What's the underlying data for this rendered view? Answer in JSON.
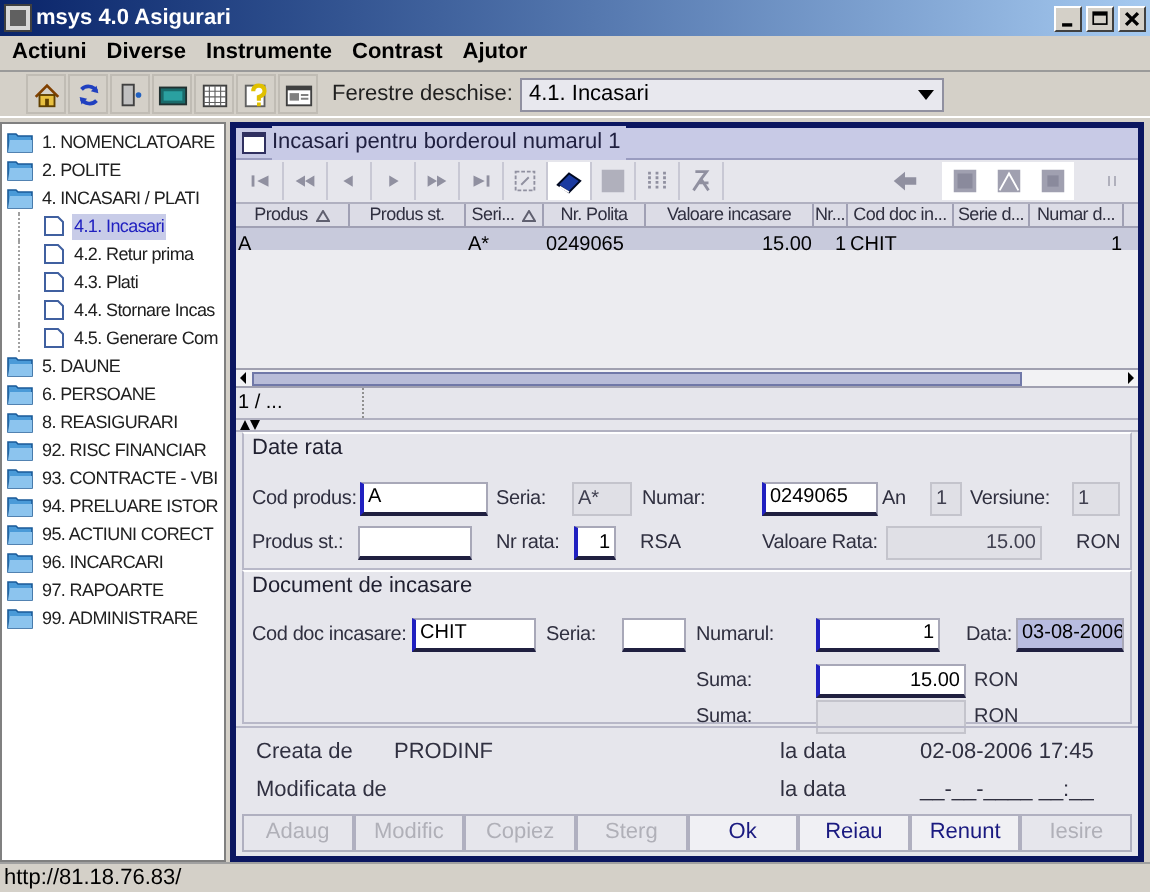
{
  "window": {
    "title": "msys 4.0 Asigurari"
  },
  "menu": [
    "Actiuni",
    "Diverse",
    "Instrumente",
    "Contrast",
    "Ajutor"
  ],
  "toolbar": {
    "open_windows_label": "Ferestre deschise:",
    "open_windows_value": "4.1. Incasari"
  },
  "tree": [
    {
      "label": "1. NOMENCLATOARE",
      "selected": false
    },
    {
      "label": "2. POLITE",
      "selected": false
    },
    {
      "label": "4. INCASARI / PLATI",
      "selected": false,
      "children": [
        {
          "label": "4.1. Incasari",
          "selected": true
        },
        {
          "label": "4.2. Retur prima",
          "selected": false
        },
        {
          "label": "4.3. Plati",
          "selected": false
        },
        {
          "label": "4.4. Stornare Incas",
          "selected": false
        },
        {
          "label": "4.5. Generare Com",
          "selected": false
        }
      ]
    },
    {
      "label": "5. DAUNE",
      "selected": false
    },
    {
      "label": "6. PERSOANE",
      "selected": false
    },
    {
      "label": "8. REASIGURARI",
      "selected": false
    },
    {
      "label": "92. RISC FINANCIAR",
      "selected": false
    },
    {
      "label": "93. CONTRACTE - VBI",
      "selected": false
    },
    {
      "label": "94. PRELUARE ISTOR",
      "selected": false
    },
    {
      "label": "95. ACTIUNI CORECT",
      "selected": false
    },
    {
      "label": "96. INCARCARI",
      "selected": false
    },
    {
      "label": "97. RAPOARTE",
      "selected": false
    },
    {
      "label": "99. ADMINISTRARE",
      "selected": false
    }
  ],
  "frame": {
    "title": "Incasari pentru borderoul numarul 1"
  },
  "table": {
    "columns": [
      {
        "label": "Produs",
        "sorted": true
      },
      {
        "label": "Produs st.",
        "sorted": false
      },
      {
        "label": "Seri...",
        "sorted": true
      },
      {
        "label": "Nr. Polita",
        "sorted": false
      },
      {
        "label": "Valoare incasare",
        "sorted": false
      },
      {
        "label": "Nr...",
        "sorted": false
      },
      {
        "label": "Cod doc in...",
        "sorted": false
      },
      {
        "label": "Serie d...",
        "sorted": false
      },
      {
        "label": "Numar d...",
        "sorted": false
      }
    ],
    "rows": [
      {
        "selected": true,
        "cells": [
          "A",
          "",
          "A*",
          "0249065",
          "15.00",
          "1",
          "CHIT",
          "",
          "1"
        ]
      }
    ],
    "record_status": "1 / ..."
  },
  "sections": [
    {
      "title": "Date rata",
      "rows": [
        {
          "fields": [
            {
              "label": "Cod produs:",
              "kind": "field",
              "value": "A",
              "required": true,
              "selected": false
            },
            {
              "label": "Seria:",
              "kind": "readonly",
              "value": "A*"
            },
            {
              "label": "Numar:",
              "kind": "field",
              "value": "0249065",
              "required": true,
              "selected": false
            },
            {
              "label": "An",
              "kind": "readonly",
              "value": "1"
            },
            {
              "label": "Versiune:",
              "kind": "readonly",
              "value": "1"
            }
          ]
        },
        {
          "fields": [
            {
              "label": "Produs st.:",
              "kind": "field",
              "required": false,
              "selected": false
            },
            {
              "label": "Nr rata:",
              "kind": "field",
              "value": "1",
              "required": true,
              "selected": false,
              "unit": "RSA"
            },
            {
              "label": "Valoare Rata:",
              "kind": "readonly",
              "value": "15.00",
              "unit": "RON"
            }
          ]
        }
      ]
    },
    {
      "title": "Document de incasare",
      "rows": [
        {
          "fields": [
            {
              "label": "Cod doc incasare:",
              "kind": "field",
              "value": "CHIT",
              "required": true,
              "selected": false
            },
            {
              "label": "Seria:",
              "kind": "field",
              "required": false,
              "selected": false
            },
            {
              "label": "Numarul:",
              "kind": "field",
              "value": "1",
              "required": true,
              "selected": false
            },
            {
              "label": "Data:",
              "kind": "field",
              "value": "03-08-2006",
              "required": false,
              "selected": true
            }
          ]
        },
        {
          "fields": [
            {
              "label": "Suma:",
              "kind": "field",
              "value": "15.00",
              "required": true,
              "selected": false,
              "unit": "RON"
            }
          ]
        },
        {
          "fields": [
            {
              "label": "Suma:",
              "kind": "readonly",
              "unit": "RON"
            }
          ]
        }
      ]
    }
  ],
  "audit": [
    {
      "label": "Creata de",
      "user": "PRODINF",
      "date_label": "la data",
      "date": "02-08-2006 17:45"
    },
    {
      "label": "Modificata de",
      "date_label": "la data",
      "date": "__-__-____ __:__"
    }
  ],
  "buttons": [
    {
      "label": "Adaug",
      "disabled": true
    },
    {
      "label": "Modific",
      "disabled": true
    },
    {
      "label": "Copiez",
      "disabled": true
    },
    {
      "label": "Sterg",
      "disabled": true
    },
    {
      "label": "Ok",
      "disabled": false
    },
    {
      "label": "Reiau",
      "disabled": false
    },
    {
      "label": "Renunt",
      "disabled": false
    },
    {
      "label": "Iesire",
      "disabled": true
    }
  ],
  "status_bar": "http://81.18.76.83/"
}
